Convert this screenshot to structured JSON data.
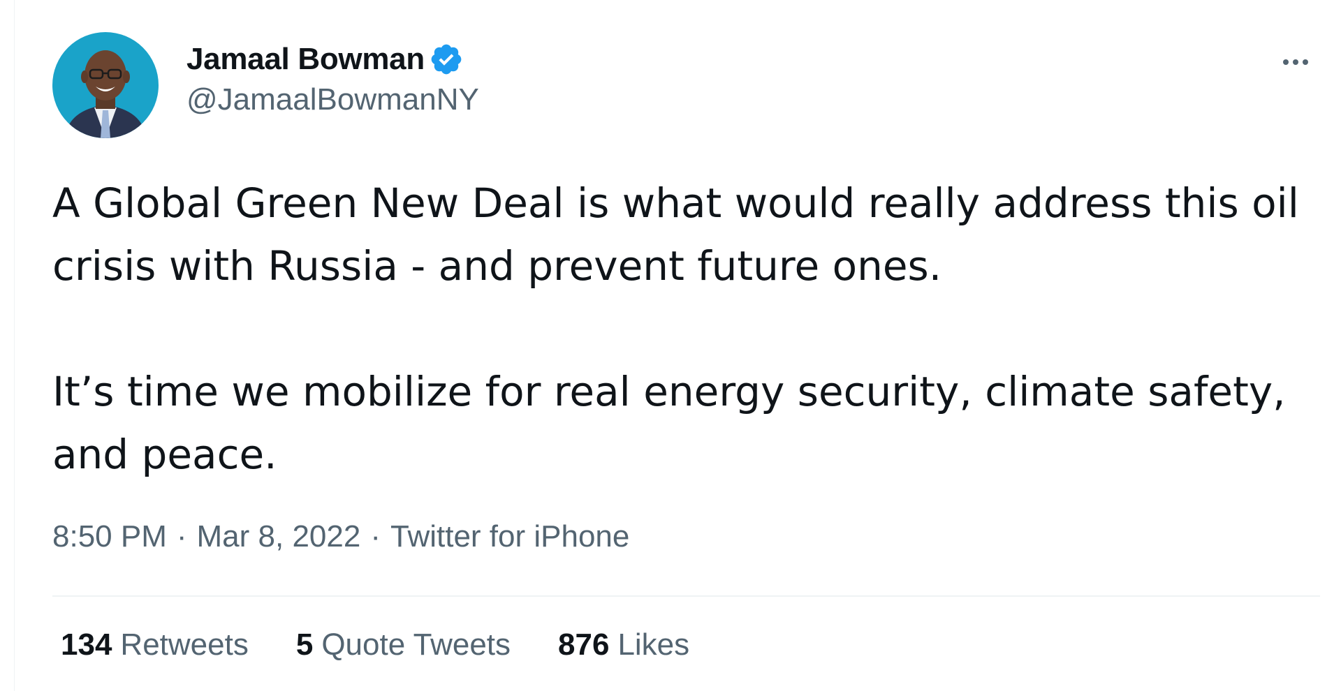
{
  "author": {
    "display_name": "Jamaal Bowman",
    "handle": "@JamaalBowmanNY",
    "verified": true,
    "verified_icon": "verified-badge-icon",
    "accent_color": "#1d9bf0"
  },
  "tweet": {
    "paragraphs": [
      "A Global Green New Deal is what would really address this oil crisis with Russia - and prevent future ones.",
      "It’s time we mobilize for real energy security, climate safety, and peace."
    ],
    "time": "8:50 PM",
    "separator": "·",
    "date": "Mar 8, 2022",
    "source": "Twitter for iPhone"
  },
  "stats": {
    "retweets": {
      "count": "134",
      "label": "Retweets"
    },
    "quotes": {
      "count": "5",
      "label": "Quote Tweets"
    },
    "likes": {
      "count": "876",
      "label": "Likes"
    }
  },
  "colors": {
    "text": "#0f1419",
    "secondary": "#536471",
    "divider": "#eff3f4",
    "avatar_bg": "#1aa3c9"
  }
}
